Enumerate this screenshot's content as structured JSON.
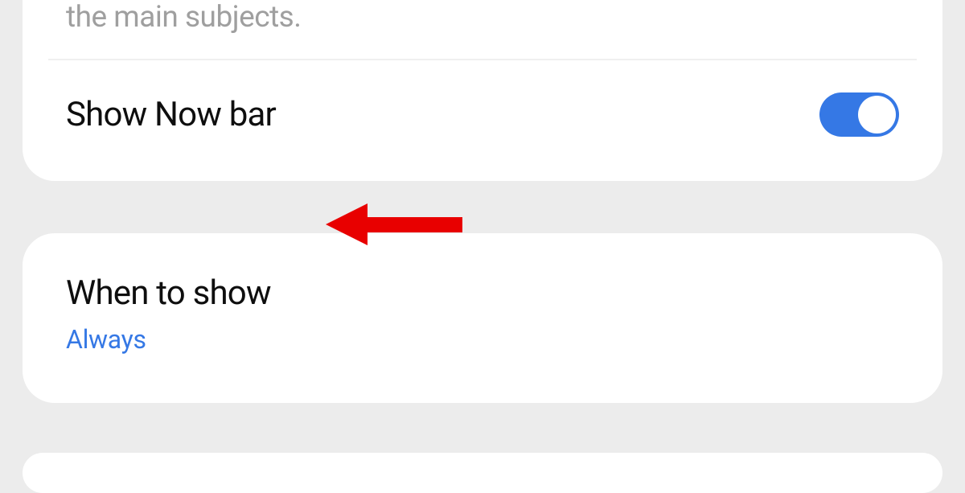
{
  "card_top": {
    "cutoff_text": "the main subjects.",
    "show_now_bar": {
      "label": "Show Now bar",
      "enabled": true
    }
  },
  "card_middle": {
    "title": "When to show",
    "value": "Always"
  },
  "colors": {
    "accent": "#3578e5",
    "background": "#ececec",
    "annotation": "#e80000"
  }
}
